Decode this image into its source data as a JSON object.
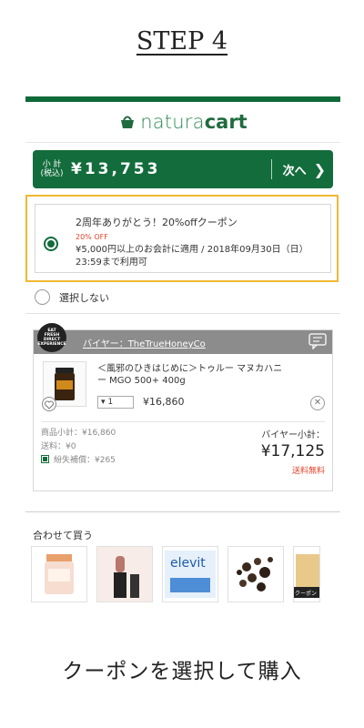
{
  "step": {
    "title": "STEP 4"
  },
  "app": {
    "brand_a": "natura",
    "brand_b": "cart"
  },
  "subtotal": {
    "label_line1": "小 計",
    "label_line2": "(税込)",
    "amount": "¥13,753",
    "next_label": "次へ"
  },
  "coupon": {
    "title": "2周年ありがとう！20%offクーポン",
    "discount": "20% OFF",
    "conditions": "¥5,000円以上のお会計に適用 / 2018年09月30日（日）23:59まで利用可",
    "selected": true
  },
  "no_select": {
    "label": "選択しない"
  },
  "buyer": {
    "logo_text": [
      "EAT",
      "FRESH",
      "DIRECT",
      "EXPERIENCE"
    ],
    "name": "バイヤー：TheTrueHoneyCo",
    "item": {
      "title": "＜風邪のひきはじめに＞トゥルー マヌカハニー MGO 500+ 400g",
      "quantity": "1",
      "price": "¥16,860"
    },
    "summary": {
      "items_subtotal": "商品小計：¥16,860",
      "shipping": "送料：¥0",
      "loss_compensation": "紛失補償：¥265"
    },
    "buyer_subtotal_label": "バイヤー小計：",
    "buyer_subtotal": "¥17,125",
    "free_shipping": "送料無料"
  },
  "also_buy": {
    "title": "合わせて買う",
    "rec_brand_text": "elevit",
    "coupon_badge": "クーポン"
  },
  "caption": "クーポンを選択して購入",
  "colors": {
    "brand_green": "#136c3b",
    "highlight": "#f2b733",
    "discount_red": "#e0452b"
  }
}
